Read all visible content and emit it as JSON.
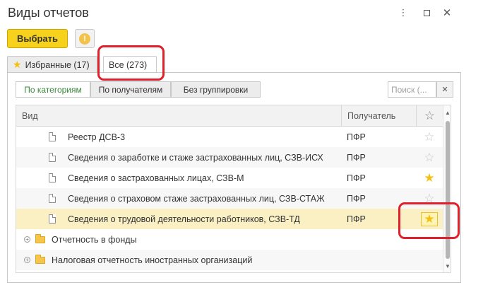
{
  "window": {
    "title": "Виды отчетов",
    "more_icon": "more-vertical-icon",
    "max_icon": "maximize-icon",
    "close_icon": "close-icon"
  },
  "toolbar": {
    "select_label": "Выбрать",
    "info_icon": "info-icon",
    "info_glyph": "!"
  },
  "tabs": [
    {
      "label": "Избранные (17)",
      "icon": "star-icon",
      "active": false
    },
    {
      "label": "Все (273)",
      "active": true
    }
  ],
  "grouping": [
    {
      "label": "По категориям",
      "active": true
    },
    {
      "label": "По получателям",
      "active": false
    },
    {
      "label": "Без группировки",
      "active": false
    }
  ],
  "search": {
    "placeholder": "Поиск (...",
    "value": ""
  },
  "table": {
    "columns": [
      "Вид",
      "Получатель"
    ],
    "star_header_icon": "star-outline-icon",
    "rows": [
      {
        "name": "Реестр ДСВ-3",
        "recipient": "ПФР",
        "favorite": false
      },
      {
        "name": "Сведения о заработке и стаже застрахованных лиц, СЗВ-ИСХ",
        "recipient": "ПФР",
        "favorite": false
      },
      {
        "name": "Сведения о застрахованных лицах, СЗВ-М",
        "recipient": "ПФР",
        "favorite": true
      },
      {
        "name": "Сведения о страховом стаже застрахованных лиц, СЗВ-СТАЖ",
        "recipient": "ПФР",
        "favorite": false
      },
      {
        "name": "Сведения о трудовой деятельности работников, СЗВ-ТД",
        "recipient": "ПФР",
        "favorite": true,
        "selected": true
      }
    ],
    "groups": [
      {
        "name": "Отчетность в фонды"
      },
      {
        "name": "Налоговая отчетность иностранных организаций"
      }
    ]
  },
  "colors": {
    "primary_button": "#f7d21c",
    "favorite_star": "#f3c010",
    "selected_row": "#fbefc4",
    "active_segment_text": "#3a8a3a",
    "highlight_box": "#e0202a"
  }
}
